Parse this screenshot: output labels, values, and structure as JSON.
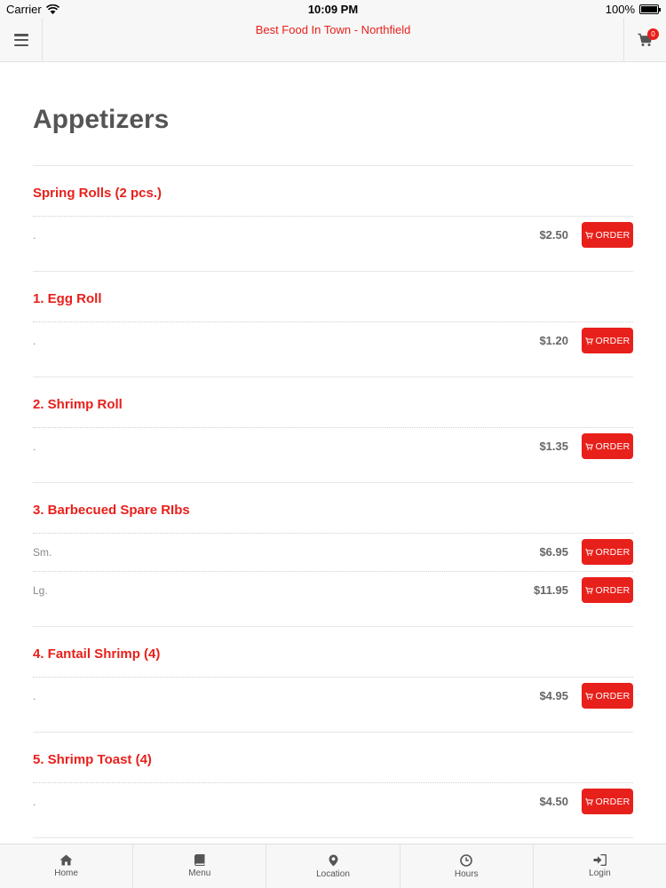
{
  "status_bar": {
    "carrier": "Carrier",
    "time": "10:09 PM",
    "battery": "100%"
  },
  "header": {
    "title": "Best Food In Town - Northfield",
    "cart_count": "0"
  },
  "section": {
    "title": "Appetizers"
  },
  "order_label": "ORDER",
  "items": [
    {
      "name": "Spring Rolls (2 pcs.)",
      "rows": [
        {
          "size": ".",
          "price": "$2.50"
        }
      ]
    },
    {
      "name": "1. Egg Roll",
      "rows": [
        {
          "size": ".",
          "price": "$1.20"
        }
      ]
    },
    {
      "name": "2. Shrimp Roll",
      "rows": [
        {
          "size": ".",
          "price": "$1.35"
        }
      ]
    },
    {
      "name": "3. Barbecued Spare RIbs",
      "rows": [
        {
          "size": "Sm.",
          "price": "$6.95"
        },
        {
          "size": "Lg.",
          "price": "$11.95"
        }
      ]
    },
    {
      "name": "4. Fantail Shrimp (4)",
      "rows": [
        {
          "size": ".",
          "price": "$4.95"
        }
      ]
    },
    {
      "name": "5. Shrimp Toast (4)",
      "rows": [
        {
          "size": ".",
          "price": "$4.50"
        }
      ]
    }
  ],
  "tabs": [
    {
      "label": "Home",
      "icon": "home-icon"
    },
    {
      "label": "Menu",
      "icon": "book-icon"
    },
    {
      "label": "Location",
      "icon": "map-pin-icon"
    },
    {
      "label": "Hours",
      "icon": "clock-icon"
    },
    {
      "label": "Login",
      "icon": "sign-in-icon"
    }
  ],
  "colors": {
    "accent": "#e8201b",
    "title_text": "#555555",
    "bar_bg": "#f7f7f7"
  }
}
